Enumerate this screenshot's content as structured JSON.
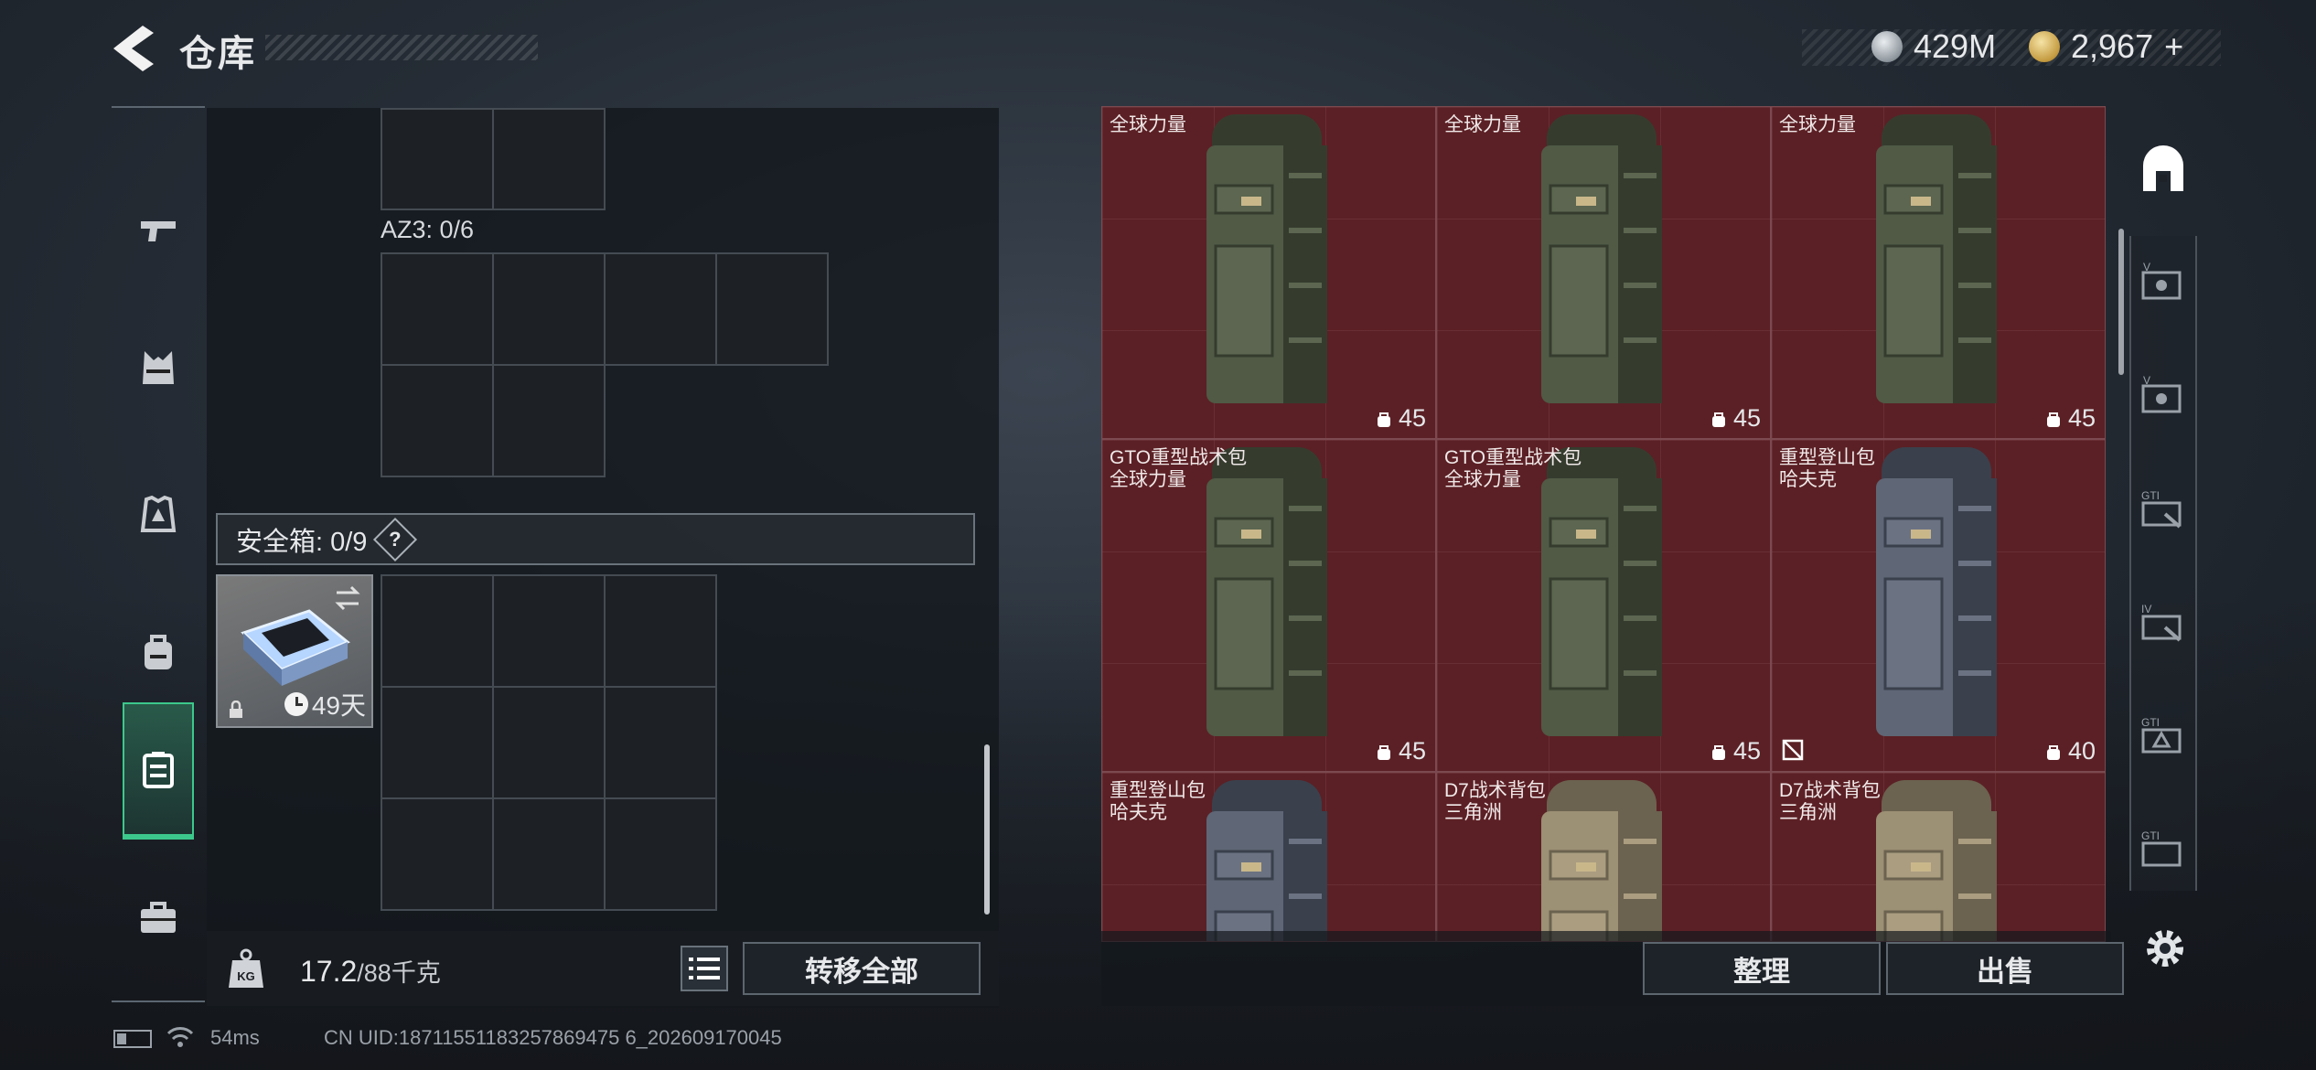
{
  "header": {
    "title": "仓库",
    "currency_silver": "429M",
    "currency_gold": "2,967",
    "add_symbol": "+"
  },
  "sidebar": {
    "items": [
      {
        "name": "weapons",
        "icon": "pistol-icon"
      },
      {
        "name": "vest",
        "icon": "chest-rig-icon"
      },
      {
        "name": "armor",
        "icon": "armor-icon"
      },
      {
        "name": "backpack",
        "icon": "backpack-icon"
      },
      {
        "name": "safe-box",
        "icon": "safe-box-icon",
        "active": true
      },
      {
        "name": "briefcase",
        "icon": "briefcase-icon"
      }
    ]
  },
  "left_panel": {
    "az3_label": "AZ3: 0/6",
    "safe_box_label": "安全箱: 0/9",
    "help": "?",
    "safe_item_days": "49天",
    "weight_current": "17.2",
    "weight_max": "/88千克",
    "transfer_all": "转移全部"
  },
  "right_panel": {
    "items": [
      {
        "name_line1": "全球力量",
        "name_line2": "",
        "capacity": "45",
        "color": "olive"
      },
      {
        "name_line1": "全球力量",
        "name_line2": "",
        "capacity": "45",
        "color": "olive"
      },
      {
        "name_line1": "全球力量",
        "name_line2": "",
        "capacity": "45",
        "color": "olive"
      },
      {
        "name_line1": "GTO重型战术包",
        "name_line2": "全球力量",
        "capacity": "45",
        "color": "olive"
      },
      {
        "name_line1": "GTO重型战术包",
        "name_line2": "全球力量",
        "capacity": "45",
        "color": "olive"
      },
      {
        "name_line1": "重型登山包",
        "name_line2": "哈夫克",
        "capacity": "40",
        "color": "slate",
        "nomod": true
      },
      {
        "name_line1": "重型登山包",
        "name_line2": "哈夫克",
        "capacity": "",
        "color": "slate"
      },
      {
        "name_line1": "D7战术背包",
        "name_line2": "三角洲",
        "capacity": "",
        "color": "tan"
      },
      {
        "name_line1": "D7战术背包",
        "name_line2": "三角洲",
        "capacity": "",
        "color": "tan"
      }
    ],
    "sort_label": "整理",
    "sell_label": "出售"
  },
  "status_bar": {
    "ping": "54ms",
    "uid": "CN UID:18711551183257869475 6_202609170045"
  },
  "colors": {
    "accent_green": "#3cc88c",
    "cell_red": "#5b2025"
  }
}
